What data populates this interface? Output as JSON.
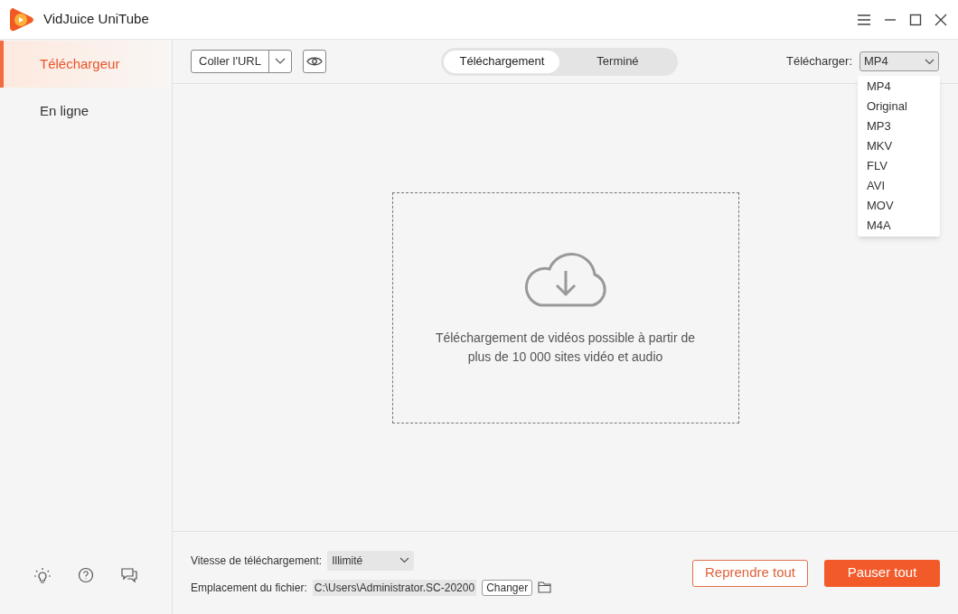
{
  "window": {
    "title": "VidJuice UniTube"
  },
  "sidebar": {
    "items": [
      {
        "label": "Téléchargeur",
        "selected": true
      },
      {
        "label": "En ligne",
        "selected": false
      }
    ]
  },
  "toolbar": {
    "paste_button": "Coller l'URL",
    "tabs": [
      {
        "label": "Téléchargement",
        "selected": true
      },
      {
        "label": "Terminé",
        "selected": false
      }
    ],
    "format_label": "Télécharger:",
    "format_value": "MP4",
    "format_expanded": true,
    "format_options": [
      "MP4",
      "Original",
      "MP3",
      "MKV",
      "FLV",
      "AVI",
      "MOV",
      "M4A"
    ]
  },
  "dropzone": {
    "text": "Téléchargement de vidéos possible à partir de plus de 10 000 sites vidéo et audio"
  },
  "footer": {
    "speed_label": "Vitesse de téléchargement:",
    "speed_value": "Illimité",
    "location_label": "Emplacement du fichier:",
    "location_value": "C:\\Users\\Administrator.SC-20200",
    "change_button": "Changer",
    "resume_button": "Reprendre tout",
    "pause_button": "Pauser tout"
  }
}
